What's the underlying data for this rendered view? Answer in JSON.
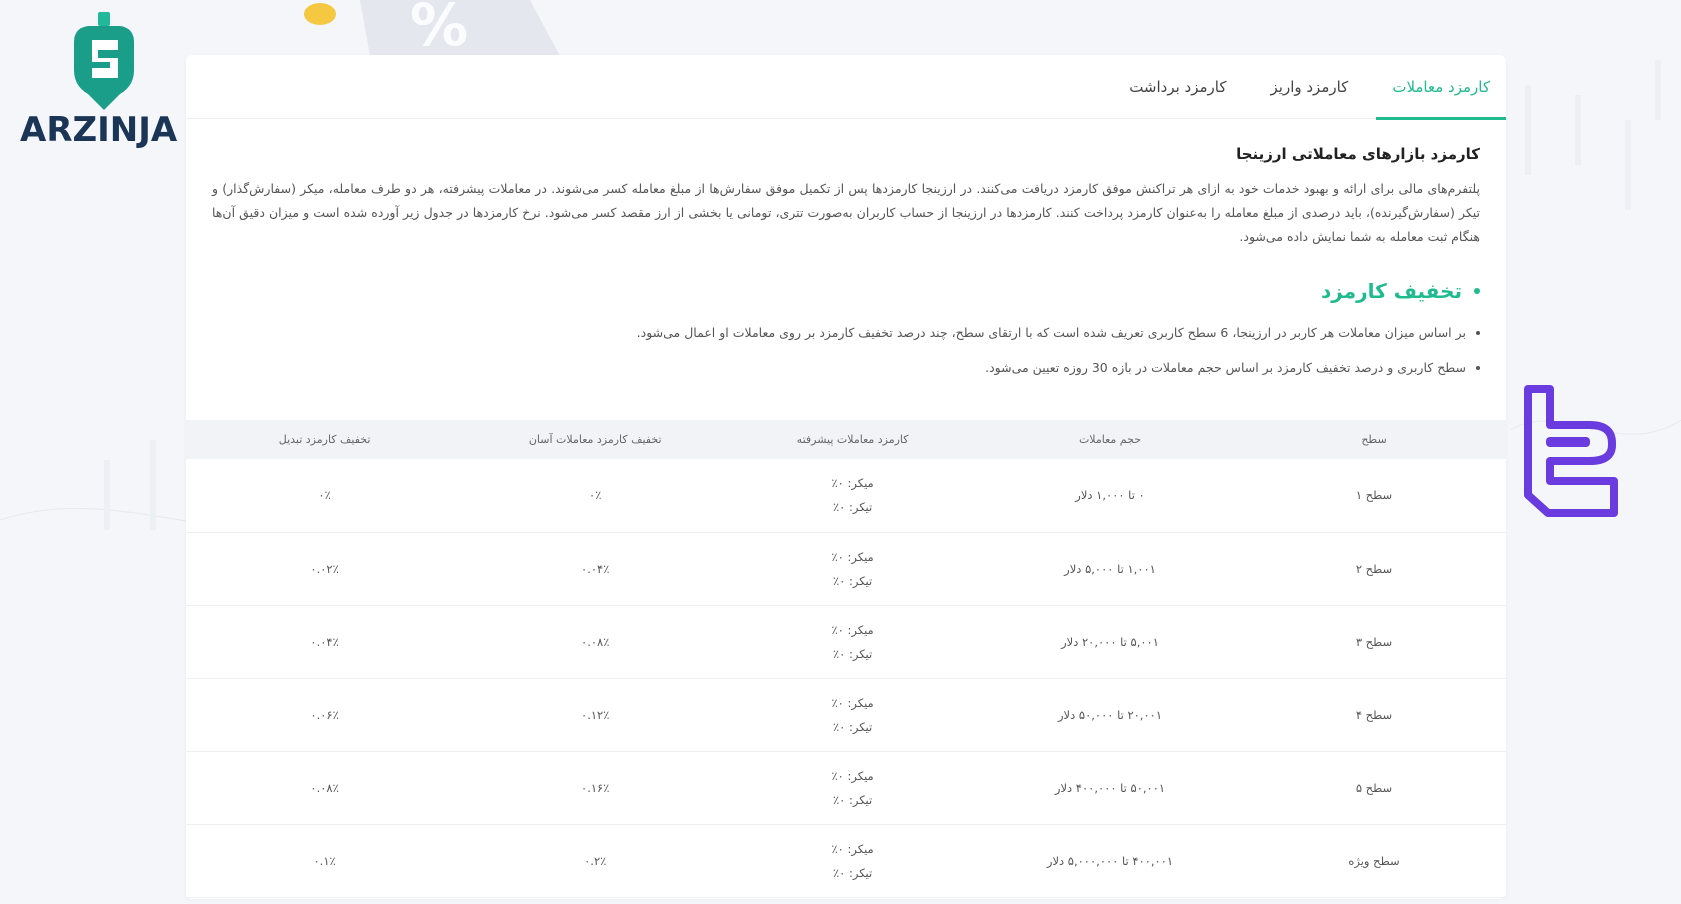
{
  "brand": {
    "name": "ARZINJA"
  },
  "tabs": [
    {
      "label": "کارمزد معاملات",
      "active": true
    },
    {
      "label": "کارمزد واریز",
      "active": false
    },
    {
      "label": "کارمزد برداشت",
      "active": false
    }
  ],
  "intro": {
    "title": "کارمزد بازارهای معاملاتی ارزینجا",
    "text": "پلتفرم‌های مالی برای ارائه و بهبود خدمات خود به ازای هر تراکنش موفق کارمزد دریافت می‌کنند. در ارزینجا کارمزدها پس از تکمیل موفق سفارش‌ها از مبلغ معامله کسر می‌شوند. در معاملات پیشرفته، هر دو طرف معامله، میکر (سفارش‌گذار) و تیکر (سفارش‌گیرنده)، باید درصدی از مبلغ معامله را به‌عنوان کارمزد پرداخت کنند. کارمزدها در ارزینجا از حساب کاربران به‌صورت تتری، تومانی یا بخشی از ارز مقصد کسر می‌شود. نرخ کارمزدها در جدول زیر آورده شده است و میزان دقیق آن‌ها هنگام ثبت معامله به شما نمایش داده می‌شود."
  },
  "discount": {
    "title": "تخفیف کارمزد",
    "bullets": [
      "بر اساس میزان معاملات هر کاربر در ارزینجا، 6 سطح کاربری تعریف شده است که با ارتقای سطح، چند درصد تخفیف کارمزد بر روی معاملات او اعمال می‌شود.",
      "سطح کاربری و درصد تخفیف کارمزد بر اساس حجم معاملات در بازه 30 روزه تعیین می‌شود."
    ]
  },
  "table": {
    "headers": [
      "سطح",
      "حجم معاملات",
      "کارمزد معاملات پیشرفته",
      "تخفیف کارمزد معاملات آسان",
      "تخفیف کارمزد تبدیل"
    ],
    "rows": [
      {
        "level": "سطح ۱",
        "volume": "۰ تا ۱,۰۰۰ دلار",
        "maker": "میکر: ۰٪",
        "taker": "تیکر: ۰٪",
        "easy": "۰٪",
        "convert": "۰٪"
      },
      {
        "level": "سطح ۲",
        "volume": "۱,۰۰۱ تا ۵,۰۰۰ دلار",
        "maker": "میکر: ۰٪",
        "taker": "تیکر: ۰٪",
        "easy": "۰.۰۴٪",
        "convert": "۰.۰۲٪"
      },
      {
        "level": "سطح ۳",
        "volume": "۵,۰۰۱ تا ۲۰,۰۰۰ دلار",
        "maker": "میکر: ۰٪",
        "taker": "تیکر: ۰٪",
        "easy": "۰.۰۸٪",
        "convert": "۰.۰۴٪"
      },
      {
        "level": "سطح ۴",
        "volume": "۲۰,۰۰۱ تا ۵۰,۰۰۰ دلار",
        "maker": "میکر: ۰٪",
        "taker": "تیکر: ۰٪",
        "easy": "۰.۱۲٪",
        "convert": "۰.۰۶٪"
      },
      {
        "level": "سطح ۵",
        "volume": "۵۰,۰۰۱ تا ۴۰۰,۰۰۰ دلار",
        "maker": "میکر: ۰٪",
        "taker": "تیکر: ۰٪",
        "easy": "۰.۱۶٪",
        "convert": "۰.۰۸٪"
      },
      {
        "level": "سطح ویژه",
        "volume": "۴۰۰,۰۰۱ تا ۵,۰۰۰,۰۰۰ دلار",
        "maker": "میکر: ۰٪",
        "taker": "تیکر: ۰٪",
        "easy": "۰.۲٪",
        "convert": "۰.۱٪"
      }
    ]
  },
  "colors": {
    "accent": "#1fbb8f",
    "watermark": "#6a3ce0",
    "logo_dark": "#1b3557"
  }
}
